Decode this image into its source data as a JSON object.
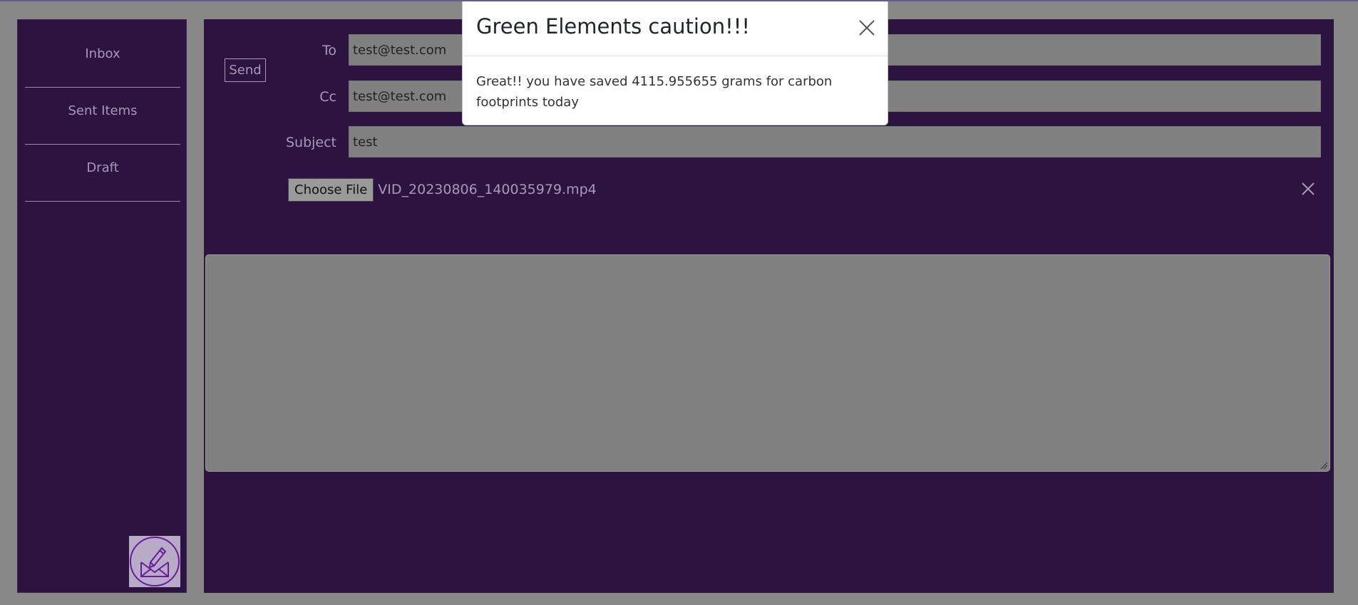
{
  "sidebar": {
    "items": [
      {
        "label": "Inbox"
      },
      {
        "label": "Sent Items"
      },
      {
        "label": "Draft"
      }
    ],
    "compose_icon": "envelope-pen-icon"
  },
  "compose": {
    "send_label": "Send",
    "to_label": "To",
    "to_value": "test@test.com",
    "cc_label": "Cc",
    "cc_value": "test@test.com",
    "subject_label": "Subject",
    "subject_value": "test",
    "choose_file_label": "Choose File",
    "attached_file": "VID_20230806_140035979.mp4",
    "remove_file_icon": "close-icon",
    "body_value": ""
  },
  "modal": {
    "title": "Green Elements caution!!!",
    "message": "Great!! you have saved 4115.955655 grams for carbon footprints today",
    "close_icon": "close-icon"
  },
  "colors": {
    "panel": "#2c1340",
    "overlay": "#888888",
    "muted_text": "#a999b8",
    "accent": "#6a1b9a"
  }
}
